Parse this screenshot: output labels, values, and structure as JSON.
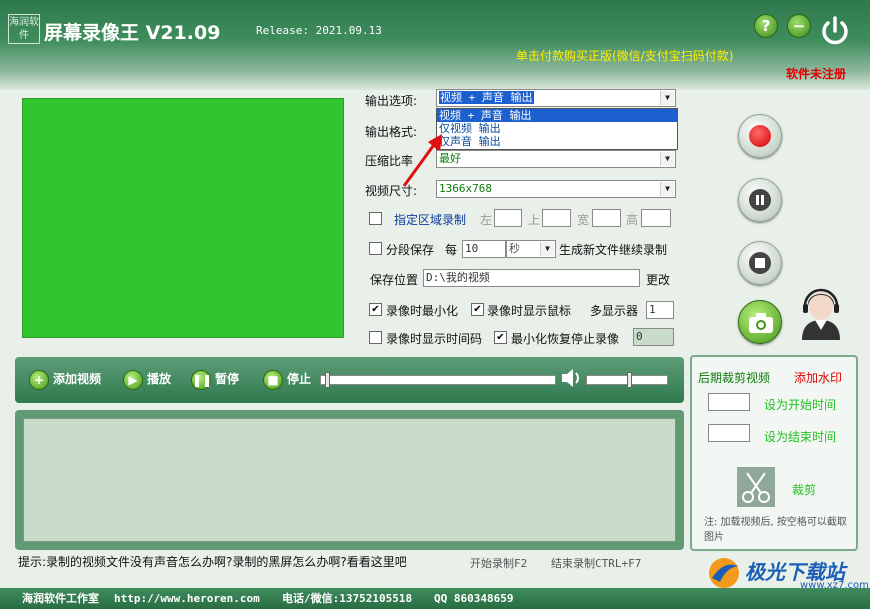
{
  "header": {
    "logo_text": "海润软件",
    "title": "屏幕录像王 V21.09",
    "release": "Release: 2021.09.13",
    "buy_text": "单击付款购买正版(微信/支付宝扫码付款)",
    "unregistered": "软件未注册",
    "help_label": "?",
    "minimize_label": "−"
  },
  "settings": {
    "output_option_label": "输出选项:",
    "output_option_value": "视频 + 声音 输出",
    "output_options": [
      "视频 + 声音 输出",
      "仅视频 输出",
      "仅声音 输出"
    ],
    "output_format_label": "输出格式:",
    "compression_label": "压缩比率",
    "compression_value": "最好",
    "video_size_label": "视频尺寸:",
    "video_size_value": "1366x768",
    "region_label": "指定区域录制",
    "left_label": "左",
    "top_label": "上",
    "width_label": "宽",
    "height_label": "高",
    "segment_label": "分段保存",
    "every_label": "每",
    "segment_value": "10",
    "segment_unit": "秒",
    "segment_suffix": "生成新文件继续录制",
    "save_location_label": "保存位置",
    "save_location_value": "D:\\我的视频",
    "change_label": "更改",
    "minimize_on_record": "录像时最小化",
    "show_mouse": "录像时显示鼠标",
    "multi_display_label": "多显示器",
    "multi_display_value": "1",
    "show_timecode": "录像时显示时间码",
    "minimize_restore_stop": "最小化恢复停止录像",
    "restore_value": "0"
  },
  "controls": {
    "add_video": "添加视频",
    "play": "播放",
    "pause": "暂停",
    "stop": "停止"
  },
  "side": {
    "trim_title": "后期裁剪视频",
    "watermark": "添加水印",
    "set_start": "设为开始时间",
    "set_end": "设为结束时间",
    "cut": "裁剪",
    "note": "注: 加载视频后, 按空格可以截取图片"
  },
  "bottom": {
    "tip": "提示:录制的视频文件没有声音怎么办啊?录制的黑屏怎么办啊?看看这里吧",
    "start_hotkey": "开始录制F2",
    "stop_hotkey": "结束录制CTRL+F7"
  },
  "footer": {
    "studio": "海润软件工作室",
    "url": "http://www.heroren.com",
    "phone": "电话/微信:13752105518",
    "qq": "QQ 860348659"
  },
  "watermark_site": {
    "name": "极光下载站",
    "url": "www.xz7.com"
  },
  "colors": {
    "header_green": "#2e7a4d",
    "preview_green": "#30c630",
    "record_red": "#e01818",
    "accent_red": "#e00000",
    "buy_yellow": "#ffef00"
  }
}
